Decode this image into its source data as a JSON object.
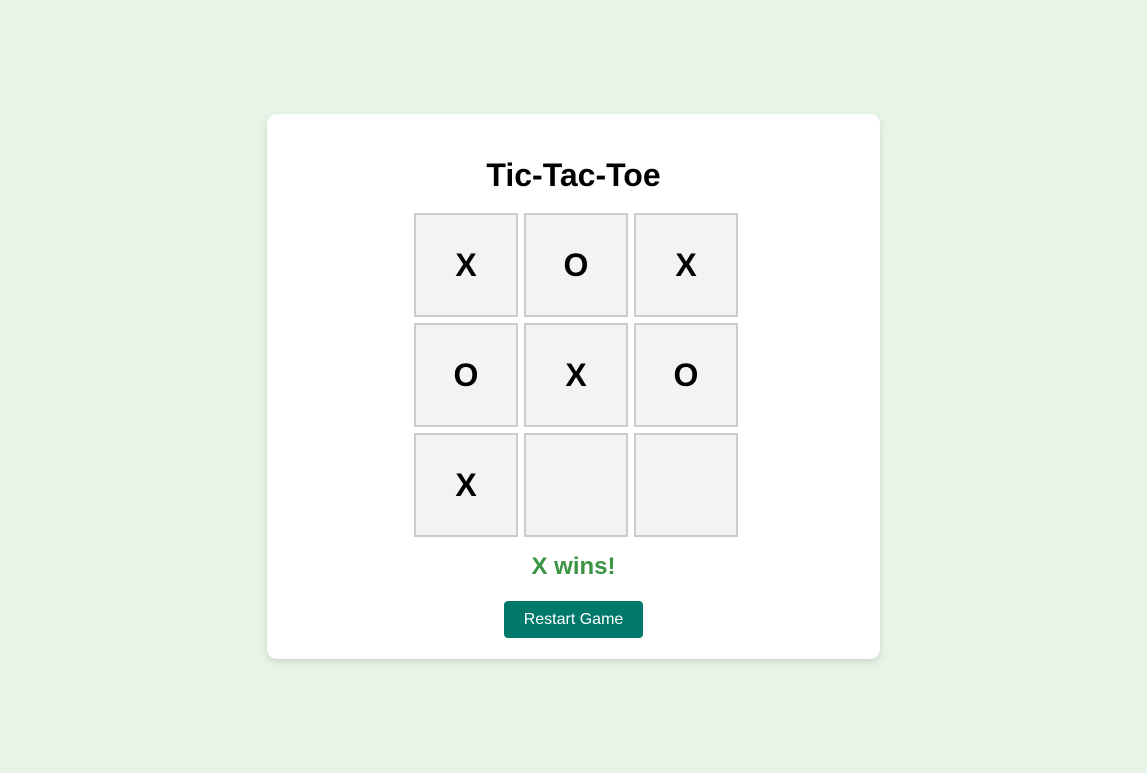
{
  "title": "Tic-Tac-Toe",
  "board": {
    "cells": [
      "X",
      "O",
      "X",
      "O",
      "X",
      "O",
      "X",
      "",
      ""
    ]
  },
  "status": {
    "text": "X wins!",
    "color": "#3a9444"
  },
  "restart": {
    "label": "Restart Game",
    "color": "#00796b"
  }
}
